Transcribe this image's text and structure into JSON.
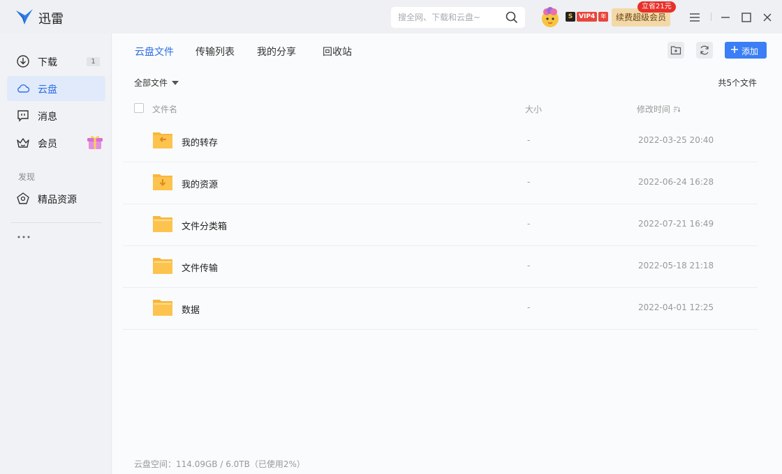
{
  "app": {
    "title": "迅雷"
  },
  "search": {
    "placeholder": "搜全网、下载和云盘~"
  },
  "vip": {
    "s_label": "S",
    "level": "VIP4",
    "year": "年"
  },
  "renew": {
    "label": "续费超级会员",
    "tip": "立省21元"
  },
  "sidebar": {
    "items": [
      {
        "label": "下载",
        "count": "1"
      },
      {
        "label": "云盘"
      },
      {
        "label": "消息"
      },
      {
        "label": "会员"
      }
    ],
    "section_label": "发现",
    "discover_items": [
      {
        "label": "精品资源"
      }
    ]
  },
  "tabs": [
    {
      "label": "云盘文件"
    },
    {
      "label": "传输列表"
    },
    {
      "label": "我的分享"
    },
    {
      "label": "回收站"
    }
  ],
  "toolbar": {
    "add_label": "添加"
  },
  "filter": {
    "label": "全部文件"
  },
  "file_count": "共5个文件",
  "columns": {
    "name": "文件名",
    "size": "大小",
    "modified": "修改时间"
  },
  "files": [
    {
      "name": "我的转存",
      "size": "-",
      "modified": "2022-03-25 20:40",
      "icon": "folder-transfer-icon"
    },
    {
      "name": "我的资源",
      "size": "-",
      "modified": "2022-06-24 16:28",
      "icon": "folder-download-icon"
    },
    {
      "name": "文件分类箱",
      "size": "-",
      "modified": "2022-07-21 16:49",
      "icon": "folder-icon"
    },
    {
      "name": "文件传输",
      "size": "-",
      "modified": "2022-05-18 21:18",
      "icon": "folder-icon"
    },
    {
      "name": "数据",
      "size": "-",
      "modified": "2022-04-01 12:25",
      "icon": "folder-icon"
    }
  ],
  "storage": "云盘空间：114.09GB / 6.0TB（已使用2%）",
  "colors": {
    "accent": "#2f6fe4",
    "add_button": "#3b7ef5",
    "folder": "#f8b63e",
    "active_nav": "#e1eafb"
  }
}
